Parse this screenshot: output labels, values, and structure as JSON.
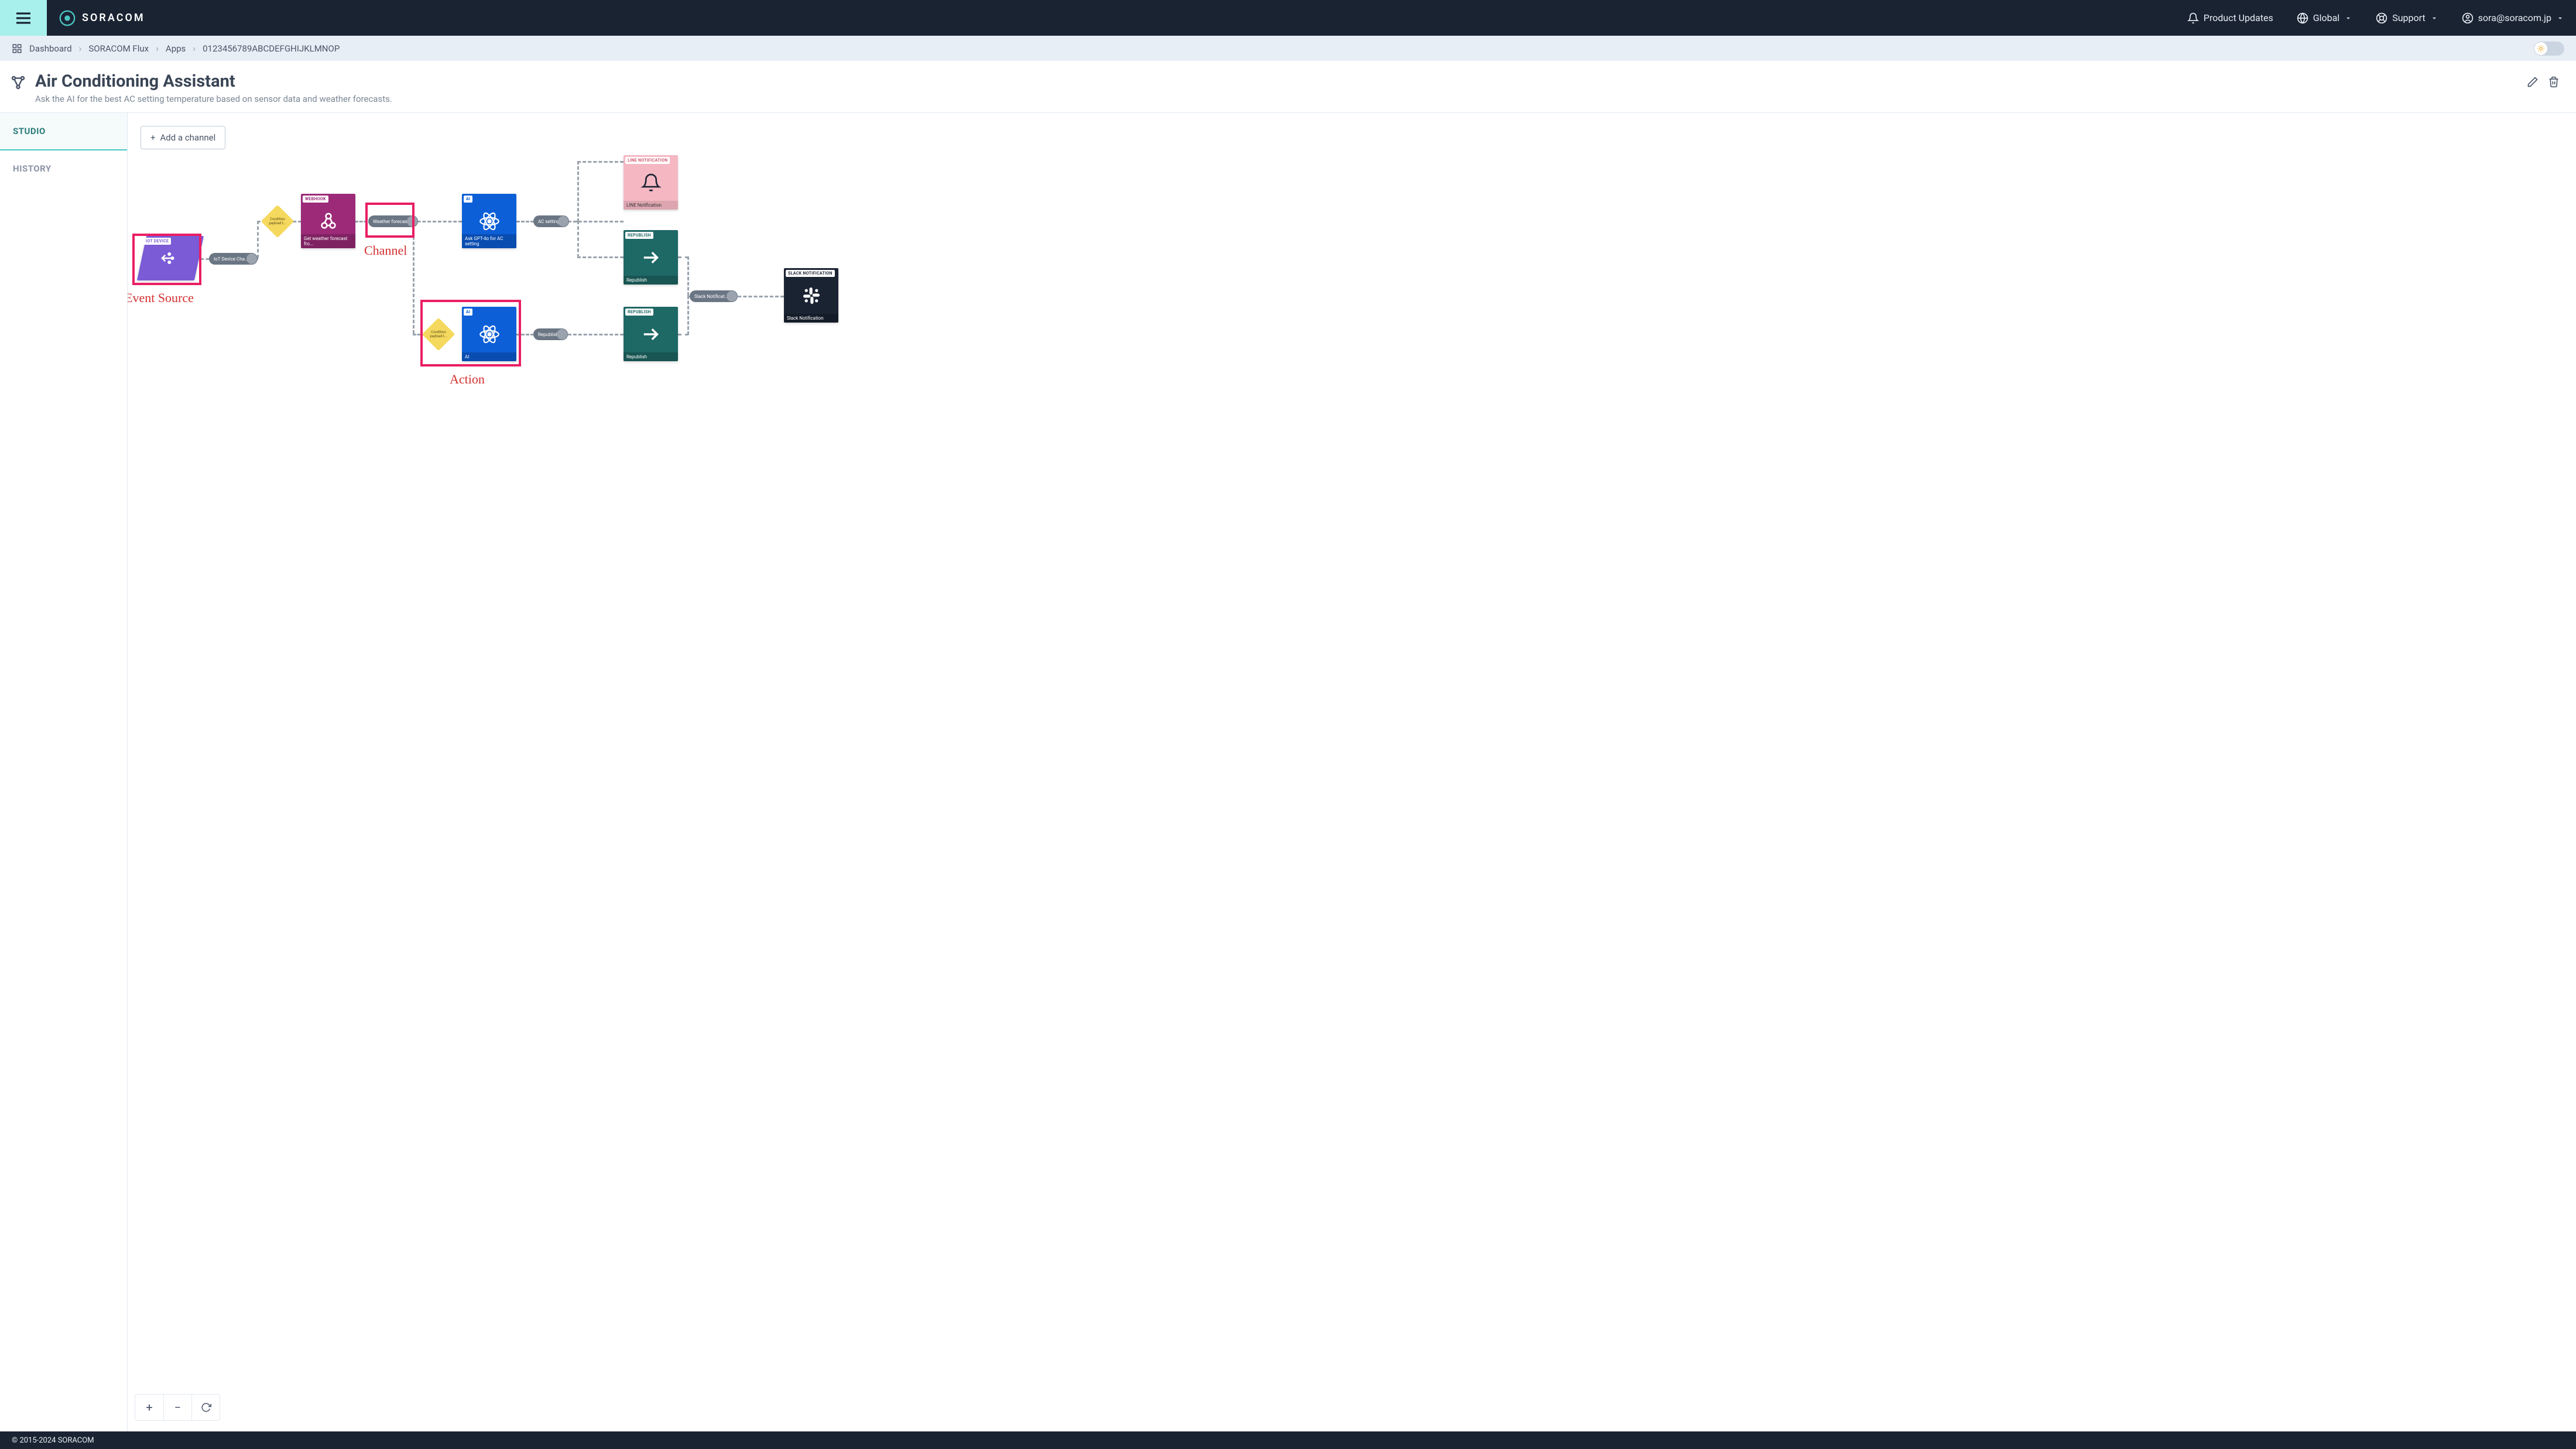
{
  "nav": {
    "brand": "SORACOM",
    "product_updates": "Product Updates",
    "region": "Global",
    "support": "Support",
    "user_email": "sora@soracom.jp"
  },
  "breadcrumbs": {
    "dashboard": "Dashboard",
    "flux": "SORACOM Flux",
    "apps": "Apps",
    "app_id": "0123456789ABCDEFGHIJKLMNOP"
  },
  "page": {
    "title": "Air Conditioning Assistant",
    "subtitle": "Ask the AI for the best AC setting temperature based on sensor data and weather forecasts."
  },
  "sidebar": {
    "studio": "STUDIO",
    "history": "HISTORY"
  },
  "toolbar": {
    "add_channel": "Add a channel"
  },
  "nodes": {
    "iot": {
      "tag": "IOT DEVICE"
    },
    "webhook": {
      "tag": "WEBHOOK",
      "footer": "Get weather forecast fro..."
    },
    "ai1": {
      "tag": "AI",
      "footer": "Ask GPT-4o for AC setting"
    },
    "ai2": {
      "tag": "AI",
      "footer": "AI"
    },
    "line": {
      "tag": "LINE NOTIFICATION",
      "footer": "LINE Notification"
    },
    "repub1": {
      "tag": "REPUBLISH",
      "footer": "Republish"
    },
    "repub2": {
      "tag": "REPUBLISH",
      "footer": "Republish"
    },
    "slack": {
      "tag": "SLACK NOTIFICATION",
      "footer": "Slack Notification"
    }
  },
  "conditions": {
    "c1": {
      "t1": "Condition",
      "t2": "payload.t..."
    },
    "c2": {
      "t1": "Condition",
      "t2": "payload.t..."
    }
  },
  "pills": {
    "iot_channel": "IoT Device Cha...",
    "weather": "Weather forecast",
    "ac_setting": "AC setting",
    "republish": "Republish",
    "slack_notif": "Slack Notificat..."
  },
  "annotations": {
    "event_source": "Event Source",
    "channel": "Channel",
    "action": "Action"
  },
  "footer": {
    "copyright": "© 2015-2024 SORACOM"
  }
}
